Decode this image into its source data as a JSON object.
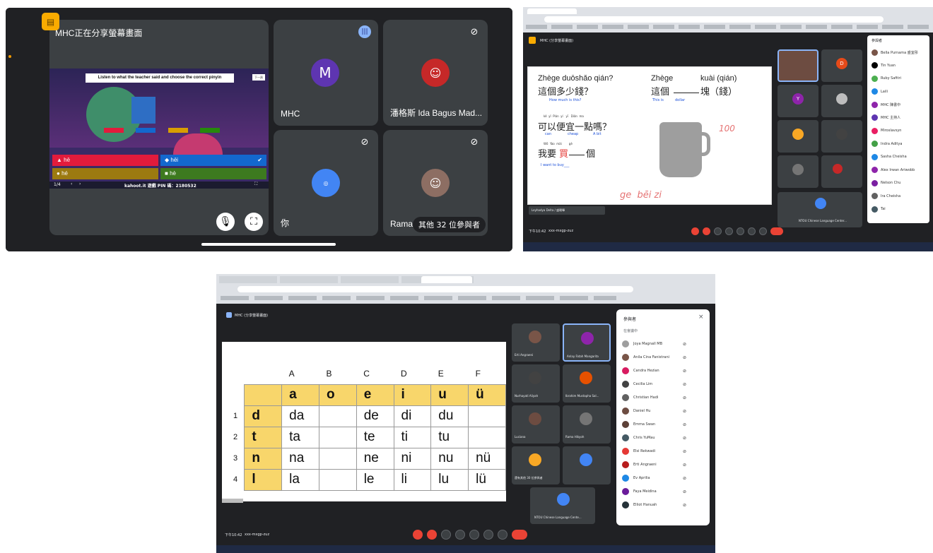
{
  "p1": {
    "share_title": "MHC正在分享螢幕畫面",
    "kahoot_question": "Listen to what the teacher said and choose the correct pinyin",
    "kahoot_skip": "下一頁",
    "answers": [
      "hē",
      "hēi",
      "hé",
      "hè"
    ],
    "kahoot_footer": "kahoot.it 遊戲 PIN 碼：2180532",
    "kahoot_counter": "1/4",
    "tile_mhc_initial": "M",
    "tile_mhc_name": "MHC",
    "tile_ida_name": "潘格斯 Ida Bagus Mad...",
    "tile_you_name": "你",
    "tile_rama_name": "Rama",
    "others": "其他 32 位參與者"
  },
  "p2": {
    "meeting_tab": "MHC (分享螢幕畫面)",
    "slide": {
      "q1_pinyin": "Zhège duōshǎo qián?",
      "q1_chinese": "這個多少錢？",
      "q1_english": "How much is this?",
      "q2_pinyin": "Zhège",
      "q2_pinyin_b": "kuài (qián)",
      "q2_chinese": "這個",
      "q2_chinese_b": "塊（錢）",
      "q2_english": "This is",
      "q2_english_b": "dollar",
      "q3_pinyin": "kě  yǐ  Pián  yí   yī   Diǎn  ma",
      "q3_chinese": "可以便宜一點嗎？",
      "q3_words": [
        "can",
        "cheap",
        "A bit"
      ],
      "q4_pinyin": "Wǒ  Yào  mǎi        gè",
      "q4_chinese_a": "我要",
      "q4_chinese_mid": "買",
      "q4_chinese_b": "個",
      "q4_english": "I want to buy___",
      "hand_price": "100",
      "hand_bottom": "ge  bēi zi"
    },
    "caption_label": "Leyhadya Delta / 盛朝暉",
    "time": "下午10:42",
    "meet_code": "xxx-mxgp-zuz",
    "tiles": {
      "d": "D",
      "y": "Y",
      "dimitri": "Dimitri",
      "ngc": "NTOU Chinese Language Center..."
    },
    "participants_title": "參與者",
    "participants": [
      "Bella Purnama 盛宜彤",
      "Tin Yuan",
      "Ruby Safitri",
      "Laili",
      "MHC 陳書中",
      "MHC 主持人",
      "Miroslavsyn",
      "Indra Aditya",
      "Sasha Cheisha",
      "Alex Irwan Ariwobb",
      "Nelson Chu",
      "Ira Cheisha",
      "Tai"
    ]
  },
  "p3": {
    "meeting_tab": "MHC (分享螢幕畫面)",
    "col_letters": [
      "A",
      "B",
      "C",
      "D",
      "E",
      "F"
    ],
    "vowels": [
      "a",
      "o",
      "e",
      "i",
      "u",
      "ü"
    ],
    "rows": [
      {
        "n": "1",
        "init": "d",
        "cells": [
          "da",
          "",
          "de",
          "di",
          "du",
          ""
        ]
      },
      {
        "n": "2",
        "init": "t",
        "cells": [
          "ta",
          "",
          "te",
          "ti",
          "tu",
          ""
        ]
      },
      {
        "n": "3",
        "init": "n",
        "cells": [
          "na",
          "",
          "ne",
          "ni",
          "nu",
          "nü"
        ]
      },
      {
        "n": "4",
        "init": "l",
        "cells": [
          "la",
          "",
          "le",
          "li",
          "lu",
          "lü"
        ]
      }
    ],
    "tile_names": [
      "Erti Angraeni",
      "Anlay Fatah Mangarita",
      "Nurhayati Aliyah",
      "Ibrahim Mustapha Sal...",
      "Luciana",
      "Rama Hikyoh",
      "還有其他 30 位參與者",
      "NTOU Chinese Language Cente..."
    ],
    "time": "下午10:42",
    "meet_code": "xxx-mxgp-zuz",
    "participants_title": "參與者",
    "participants_section": "在會議中",
    "participants": [
      "Joya Magnall MB",
      "Anila Cina Fanistrani",
      "Candra Hezian",
      "Cecilia Lim",
      "Christian Hadi",
      "Daniel Hu",
      "Emma Swan",
      "Chris YuMau",
      "Elsi Rekwadi",
      "Erti Angraeni",
      "Ev Aprilia",
      "Faya Meidina",
      "Elliot Hanuah"
    ],
    "colors": {
      "red": "#ea4335",
      "yellow": "#f8d66b"
    }
  }
}
